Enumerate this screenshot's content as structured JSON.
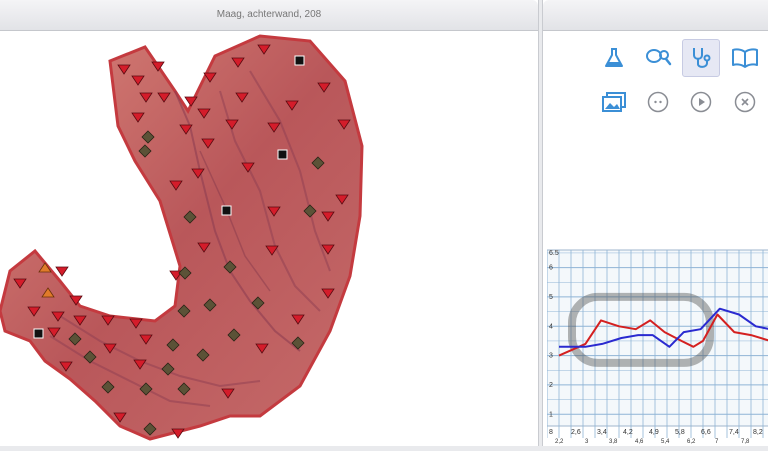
{
  "window": {
    "title": "Maag, achterwand, 208"
  },
  "toolbar": {
    "row1": [
      {
        "name": "flask-icon"
      },
      {
        "name": "search-tag-icon"
      },
      {
        "name": "stethoscope-icon",
        "active": true
      },
      {
        "name": "book-icon"
      }
    ],
    "row2": [
      {
        "name": "gallery-icon"
      },
      {
        "name": "more-icon"
      },
      {
        "name": "play-icon"
      },
      {
        "name": "close-icon"
      }
    ]
  },
  "colors": {
    "accent": "#3b8fd6",
    "marker_red": "#d41c2a",
    "marker_olive": "#5b5237",
    "marker_orange": "#e07b2a"
  },
  "chart_data": {
    "type": "line",
    "y_ticks": [
      "1",
      "2",
      "3",
      "4",
      "5",
      "6",
      "6.5"
    ],
    "x_ticks_top": [
      "8",
      "2,6",
      "3,4",
      "4,2",
      "4,9",
      "5,8",
      "6,6",
      "7,4",
      "8,2"
    ],
    "x_ticks_bottom": [
      "2,2",
      "3",
      "3,8",
      "4,6",
      "5,4",
      "6,2",
      "7",
      "7,8"
    ],
    "ylim": [
      0.6,
      6.6
    ],
    "series": [
      {
        "color": "#d42020",
        "values": [
          [
            1.0,
            3.0
          ],
          [
            3.2,
            3.4
          ],
          [
            4.5,
            4.2
          ],
          [
            6.0,
            4.0
          ],
          [
            7.4,
            3.9
          ],
          [
            8.6,
            4.2
          ],
          [
            9.8,
            3.8
          ],
          [
            11.2,
            3.5
          ],
          [
            12.2,
            3.3
          ],
          [
            13.0,
            3.5
          ],
          [
            14.2,
            4.4
          ],
          [
            15.6,
            3.8
          ],
          [
            17.0,
            3.7
          ],
          [
            18.6,
            3.5
          ]
        ]
      },
      {
        "color": "#2a2ad0",
        "values": [
          [
            1.0,
            3.3
          ],
          [
            3.2,
            3.3
          ],
          [
            4.6,
            3.4
          ],
          [
            6.2,
            3.6
          ],
          [
            7.6,
            3.7
          ],
          [
            8.8,
            3.7
          ],
          [
            10.2,
            3.3
          ],
          [
            11.4,
            3.8
          ],
          [
            12.8,
            3.9
          ],
          [
            14.4,
            4.6
          ],
          [
            16.0,
            4.4
          ],
          [
            17.4,
            4.0
          ],
          [
            18.6,
            3.9
          ]
        ]
      }
    ]
  }
}
